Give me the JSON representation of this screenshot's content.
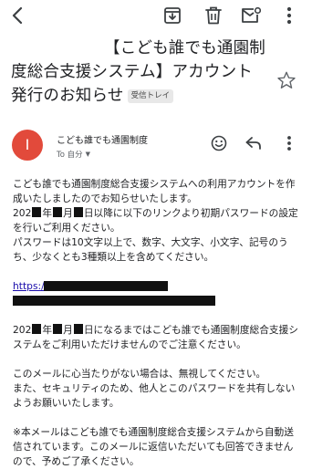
{
  "toolbar": {
    "back_icon": "arrow-back-icon",
    "archive_icon": "archive-icon",
    "delete_icon": "trash-icon",
    "mark_unread_icon": "mail-unread-icon",
    "more_icon": "more-vert-icon"
  },
  "subject": {
    "text": "【こども誰でも通園制度総合支援システム】アカウント発行のお知らせ",
    "label": "受信トレイ"
  },
  "message": {
    "avatar_letter": "I",
    "avatar_color": "#e24a3b",
    "sender": "こども誰でも通園制度",
    "to": "To 自分"
  },
  "body": {
    "para1": "こども誰でも通園制度総合支援システムへの利用アカウントを作成いたしましたのでお知らせいたします。",
    "para2_a": "202",
    "para2_b": "年",
    "para2_c": "月",
    "para2_d": "日以降に以下のリンクより初期パスワードの設定を行いご利用ください。",
    "para3": "パスワードは10文字以上で、数字、大文字、小文字、記号のうち、少なくとも3種類以上を含めてください。",
    "link_prefix": "https://",
    "para4_a": "202",
    "para4_b": "年",
    "para4_c": "月",
    "para4_d": "日になるまではこども誰でも通園制度総合支援システムをご利用いただけませんのでご注意ください。",
    "para5": "このメールに心当たりがない場合は、無視してください。",
    "para6": "また、セキュリティのため、他人とこのパスワードを共有しないようお願いいたします。",
    "para7": "※本メールはこども誰でも通園制度総合支援システムから自動送信されています。このメールに返信いただいても回答できませんので、予めご了承ください。"
  }
}
